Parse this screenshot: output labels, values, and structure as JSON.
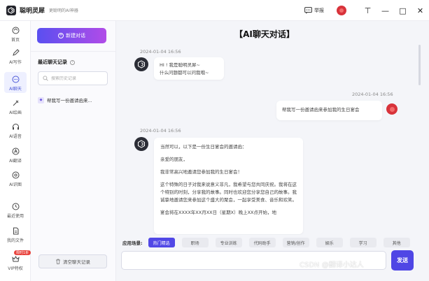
{
  "app": {
    "name": "聪明灵犀",
    "tagline": "更聪明的AI神器",
    "report_label": "举报"
  },
  "window_controls": {
    "pin": "⊤",
    "minimize": "—",
    "maximize": "□",
    "close": "✕"
  },
  "rail": {
    "items": [
      {
        "label": "首页",
        "icon": "home-icon"
      },
      {
        "label": "AI写作",
        "icon": "pen-icon"
      },
      {
        "label": "AI聊天",
        "icon": "chat-icon",
        "active": true
      },
      {
        "label": "AI绘画",
        "icon": "paint-icon"
      },
      {
        "label": "AI语音",
        "icon": "headphone-icon"
      },
      {
        "label": "AI翻译",
        "icon": "translate-icon"
      },
      {
        "label": "AI识图",
        "icon": "image-scan-icon"
      },
      {
        "label": "最近使用",
        "icon": "history-icon"
      },
      {
        "label": "我的文件",
        "icon": "file-icon"
      },
      {
        "label": "VIP特权",
        "icon": "vip-icon",
        "badge": "限时1折"
      }
    ]
  },
  "history": {
    "new_chat_label": "新建对话",
    "recent_title": "最近聊天记录",
    "search_placeholder": "搜索历史记录",
    "items": [
      {
        "label": "帮我写一份邀请函来..."
      }
    ],
    "clear_label": "清空聊天记录"
  },
  "chat": {
    "title": "【AI聊天对话】",
    "messages": [
      {
        "role": "bot",
        "time": "2024-01-04 16:56",
        "lines": [
          "HI ! 我是聪明灵犀~",
          "什么问题都可以问我哦~"
        ]
      },
      {
        "role": "user",
        "time": "2024-01-04 16:56",
        "text": "帮我写一份邀请函来参加我的生日宴会"
      },
      {
        "role": "bot",
        "time": "2024-01-04 16:56",
        "paragraphs": [
          "当然可以，以下是一份生日宴会的邀请函：",
          "亲爱的朋友，",
          "我非常高兴地邀请您参加我的生日宴会！",
          "这个特殊的日子对我来说意义非凡，我希望与您共同庆祝。我将在这个特别的时刻，分享我的故事。同时也欢迎您分享您自己的故事。我诚挚地邀请您来参加这个盛大的聚会，一起享受美食、音乐和欢笑。",
          "宴会将在XXXX年XX月XX日（星期X）晚上XX点开始，地"
        ]
      }
    ]
  },
  "scenes": {
    "label": "应用场景:",
    "chips": [
      {
        "label": "热门精选",
        "active": true
      },
      {
        "label": "职场"
      },
      {
        "label": "专业训练"
      },
      {
        "label": "代码助手"
      },
      {
        "label": "营销/创作"
      },
      {
        "label": "娱乐"
      },
      {
        "label": "学习"
      },
      {
        "label": "其他"
      }
    ]
  },
  "composer": {
    "send_label": "发送"
  },
  "watermark": "CSDN @翻译小达人"
}
